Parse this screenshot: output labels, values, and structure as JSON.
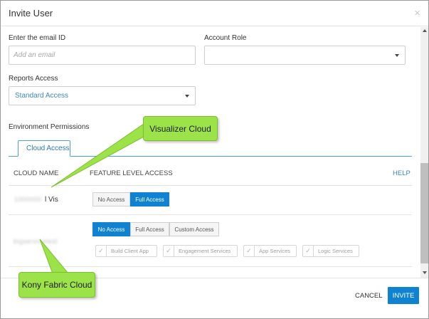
{
  "dialog": {
    "title": "Invite User",
    "close_icon": "close-icon"
  },
  "form": {
    "email": {
      "label": "Enter the email ID",
      "placeholder": "Add an email",
      "value": ""
    },
    "account_role": {
      "label": "Account Role",
      "value": ""
    },
    "reports_access": {
      "label": "Reports Access",
      "value": "Standard Access"
    },
    "env_permissions_label": "Environment Permissions"
  },
  "tabs": [
    {
      "label": "Cloud Access",
      "active": true
    }
  ],
  "table": {
    "col_cloud": "CLOUD NAME",
    "col_feature": "FEATURE LEVEL ACCESS",
    "help": "HELP",
    "rows": [
      {
        "name_blurred": "1000000",
        "name_suffix": "l Vis",
        "segments": [
          "No Access",
          "Full Access"
        ],
        "selected": "Full Access"
      },
      {
        "name_blurred": "bigservicetest",
        "segments": [
          "No Access",
          "Full Access",
          "Custom Access"
        ],
        "selected": "No Access",
        "features": [
          "Build Client App",
          "Engagement Services",
          "App Services",
          "Logic Services"
        ]
      }
    ]
  },
  "footer": {
    "cancel_label": "CANCEL",
    "invite_label": "INVITE"
  },
  "callouts": {
    "visualizer": "Visualizer Cloud",
    "fabric": "Kony Fabric Cloud"
  },
  "colors": {
    "accent": "#0f83d2",
    "callout_green": "#9ce34a",
    "link": "#3d87c4"
  }
}
